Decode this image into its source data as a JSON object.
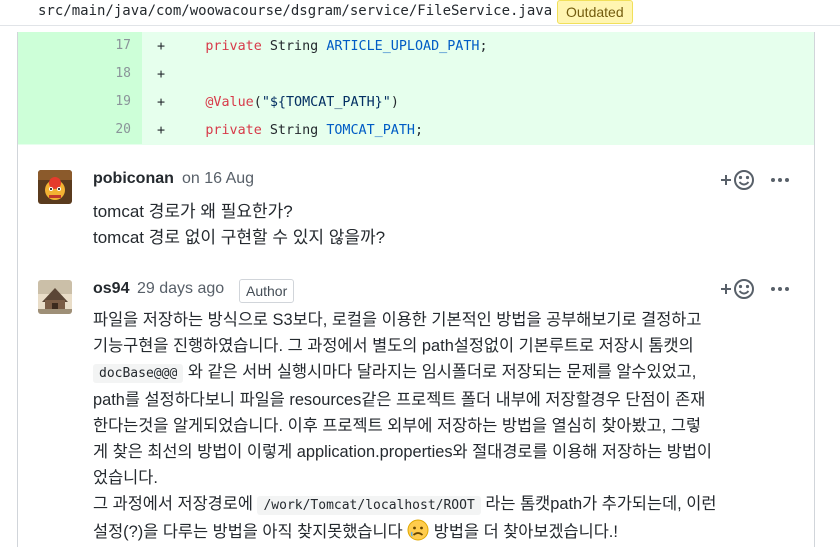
{
  "file": {
    "path": "src/main/java/com/woowacourse/dsgram/service/FileService.java",
    "badge": "Outdated"
  },
  "diff": {
    "lines": [
      {
        "num": "17",
        "plus": "+",
        "indent": "     ",
        "kw": "private",
        "type": " String ",
        "name": "ARTICLE_UPLOAD_PATH",
        "end": ";"
      },
      {
        "num": "18",
        "plus": "+"
      },
      {
        "num": "19",
        "plus": "+",
        "annotation": "@Value",
        "open": "(",
        "value": "\"${TOMCAT_PATH}\"",
        "close": ")"
      },
      {
        "num": "20",
        "plus": "+",
        "kw": "private",
        "type": " String ",
        "name": "TOMCAT_PATH",
        "end": ";"
      }
    ]
  },
  "comments": [
    {
      "author": "pobiconan",
      "meta": "on 16 Aug",
      "body": [
        "tomcat 경로가 왜 필요한가?",
        "tomcat 경로 없이 구현할 수 있지 않을까?"
      ]
    },
    {
      "author": "os94",
      "meta": "29 days ago",
      "badge": "Author",
      "p1_line1": "파일을 저장하는 방식으로 S3보다, 로컬을 이용한 기본적인 방법을 공부해보기로 결정하고",
      "p1_line2": "기능구현을 진행하였습니다. 그 과정에서 별도의 path설정없이 기본루트로 저장시 톰캣의",
      "code1": "docBase@@@",
      "p1_line3_after": " 와 같은 서버 실행시마다 달라지는 임시폴더로 저장되는 문제를 알수있었고,",
      "p1_line4": "path를 설정하다보니 파일을 resources같은 프로젝트 폴더 내부에 저장할경우 단점이 존재",
      "p1_line5": "한다는것을 알게되었습니다. 이후 프로젝트 외부에 저장하는 방법을 열심히 찾아봤고, 그렇",
      "p1_line6": "게 찾은 최선의 방법이 이렇게 application.properties와 절대경로를 이용해 저장하는 방법이",
      "p1_line7": "었습니다.",
      "p2_before": "그 과정에서 저장경로에 ",
      "code2": "/work/Tomcat/localhost/ROOT",
      "p2_after": " 라는 톰캣path가 추가되는데, 이런",
      "p2_line2_before": "설정(?)을 다루는 방법을 아직 찾지못했습니다 ",
      "p2_line2_after": " 방법을 더 찾아보겠습니다.!"
    }
  ],
  "icons": {
    "add_reaction": "smiley-plus-icon",
    "more": "kebab-icon",
    "sad": "disappointed-emoji-icon"
  },
  "colors": {
    "added_bg": "#e6ffed",
    "added_num_bg": "#cdffd8",
    "badge_bg": "#fff5b1",
    "keyword": "#d73a49",
    "constant": "#005cc5"
  }
}
